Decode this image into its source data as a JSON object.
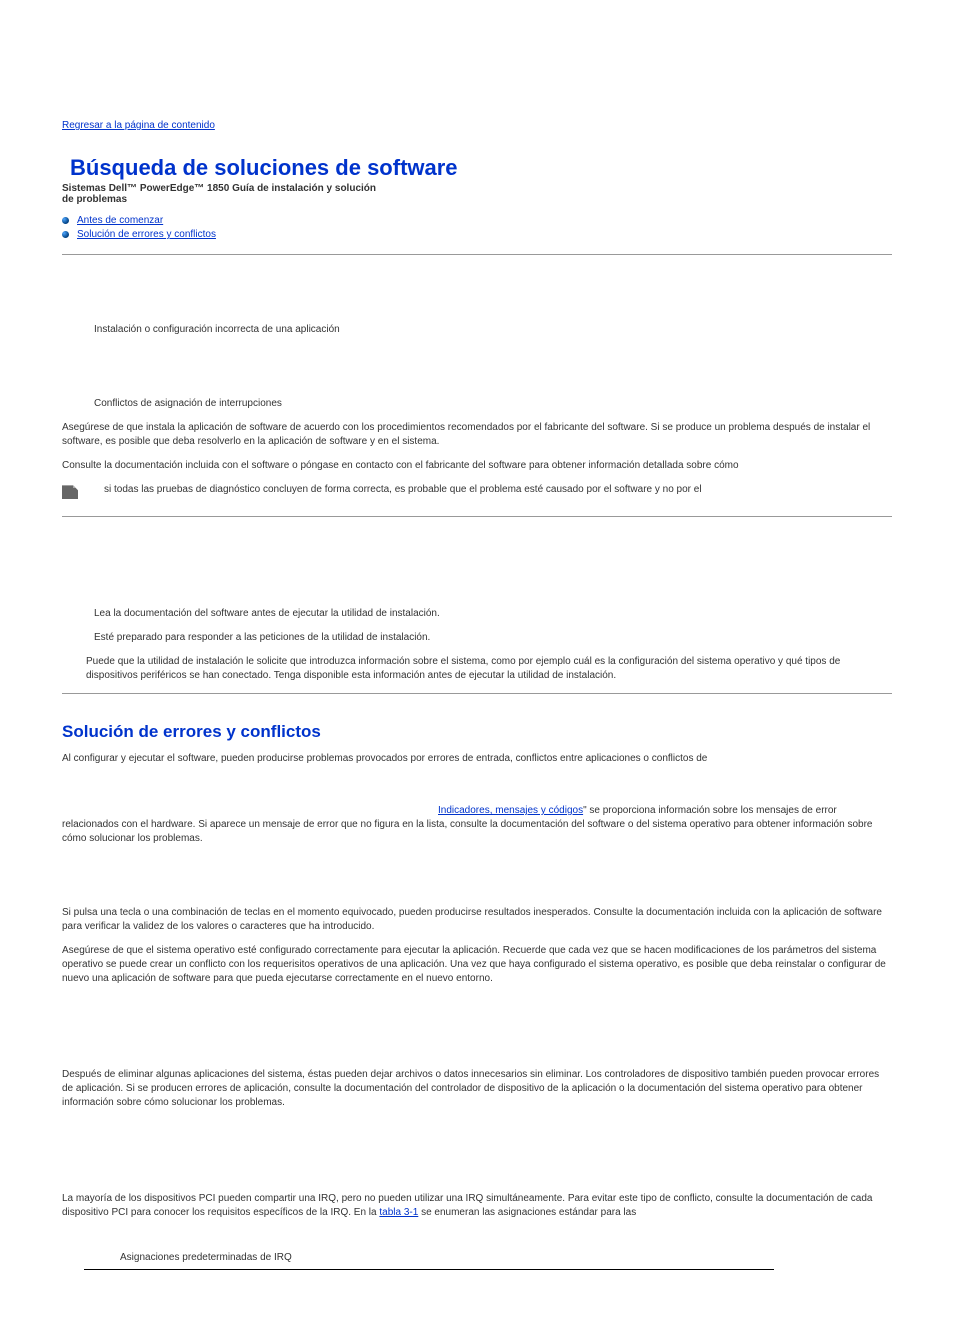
{
  "topLink": "Regresar a la página de contenido",
  "title": "Búsqueda de soluciones de software",
  "subtitle": "Sistemas Dell™ PowerEdge™ 1850  Guía de instalación y solución de problemas",
  "nav": [
    {
      "label": "Antes de comenzar"
    },
    {
      "label": "Solución de errores y conflictos"
    }
  ],
  "intro": {
    "b1": "Instalación o configuración incorrecta de una aplicación",
    "b2": "Conflictos de asignación de interrupciones",
    "p1": "Asegúrese de que instala la aplicación de software de acuerdo con los procedimientos recomendados por el fabricante del software. Si se produce un problema después de instalar el software, es posible que deba resolverlo en la aplicación de software y en el sistema.",
    "p2": "Consulte la documentación incluida con el software o póngase en contacto con el fabricante del software para obtener información detallada sobre cómo",
    "note": "si todas las pruebas de diagnóstico concluyen de forma correcta, es probable que el problema esté causado por el software y no por el"
  },
  "before": {
    "b1": "Lea la documentación del software antes de ejecutar la utilidad de instalación.",
    "b2": "Esté preparado para responder a las peticiones de la utilidad de instalación.",
    "p1": "Puede que la utilidad de instalación le solicite que introduzca información sobre el sistema, como por ejemplo cuál es la configuración del sistema operativo y qué tipos de dispositivos periféricos se han conectado. Tenga disponible esta información antes de ejecutar la utilidad de instalación."
  },
  "sectionTitle": "Solución de errores y conflictos",
  "sol": {
    "p1": "Al configurar y ejecutar el software, pueden producirse problemas provocados por errores de entrada, conflictos entre aplicaciones o conflictos de",
    "link1": "Indicadores, mensajes y códigos",
    "p2a": "\" se proporciona información sobre los mensajes de error relacionados con el hardware. Si aparece un mensaje de error que no figura en la lista, consulte la documentación del software o del sistema operativo para obtener información sobre cómo solucionar los problemas.",
    "p3": "Si pulsa una tecla o una combinación de teclas en el momento equivocado, pueden producirse resultados inesperados. Consulte la documentación incluida con la aplicación de software para verificar la validez de los valores o caracteres que ha introducido.",
    "p4": "Asegúrese de que el sistema operativo esté configurado correctamente para ejecutar la aplicación. Recuerde que cada vez que se hacen modificaciones de los parámetros del sistema operativo se puede crear un conflicto con los requerisitos operativos de una aplicación. Una vez que haya configurado el sistema operativo, es posible que deba reinstalar o configurar de nuevo una aplicación de software para que pueda ejecutarse correctamente en el nuevo entorno.",
    "p5": "Después de eliminar algunas aplicaciones del sistema, éstas pueden dejar archivos o datos innecesarios sin eliminar. Los controladores de dispositivo también pueden provocar errores de aplicación. Si se producen errores de aplicación, consulte la documentación del controlador de dispositivo de la aplicación o la documentación del sistema operativo para obtener información sobre cómo solucionar los problemas.",
    "p6a": "La mayoría de los dispositivos PCI pueden compartir una IRQ, pero no pueden utilizar una IRQ simultáneamente. Para evitar este tipo de conflicto, consulte la documentación de cada dispositivo PCI para conocer los requisitos específicos de la IRQ. En la ",
    "link2": "tabla 3-1",
    "p6b": " se enumeran las asignaciones estándar para las"
  },
  "tableCaption": "Asignaciones predeterminadas de IRQ"
}
